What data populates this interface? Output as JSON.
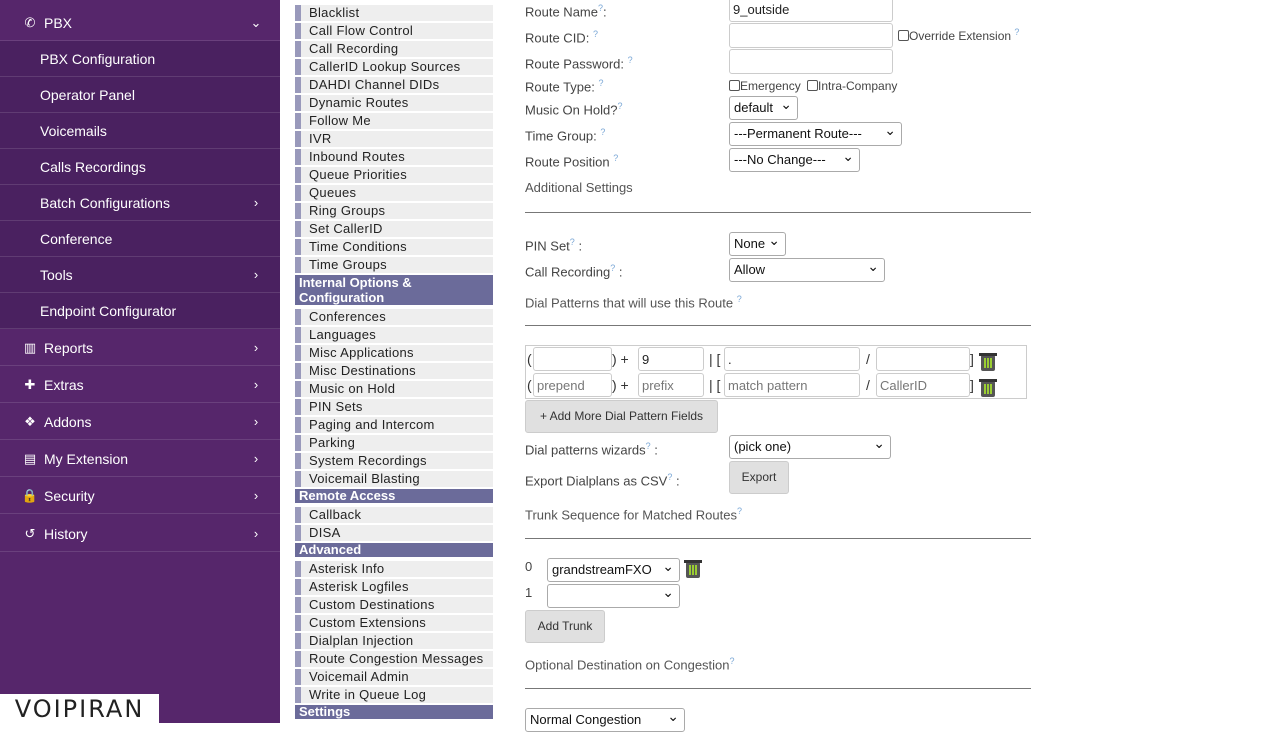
{
  "sidebar": {
    "items": [
      {
        "icon": "phone-icon",
        "glyph": "✆",
        "label": "PBX",
        "chevron": "⌄",
        "sub": false
      },
      {
        "icon": "",
        "glyph": "",
        "label": "PBX Configuration",
        "chevron": "",
        "sub": true
      },
      {
        "icon": "",
        "glyph": "",
        "label": "Operator Panel",
        "chevron": "",
        "sub": true
      },
      {
        "icon": "",
        "glyph": "",
        "label": "Voicemails",
        "chevron": "",
        "sub": true
      },
      {
        "icon": "",
        "glyph": "",
        "label": "Calls Recordings",
        "chevron": "",
        "sub": true
      },
      {
        "icon": "",
        "glyph": "",
        "label": "Batch Configurations",
        "chevron": "›",
        "sub": true
      },
      {
        "icon": "",
        "glyph": "",
        "label": "Conference",
        "chevron": "",
        "sub": true
      },
      {
        "icon": "",
        "glyph": "",
        "label": "Tools",
        "chevron": "›",
        "sub": true
      },
      {
        "icon": "",
        "glyph": "",
        "label": "Endpoint Configurator",
        "chevron": "",
        "sub": true
      },
      {
        "icon": "bar-chart-icon",
        "glyph": "▥",
        "label": "Reports",
        "chevron": "›",
        "sub": false
      },
      {
        "icon": "plus-icon",
        "glyph": "✚",
        "label": "Extras",
        "chevron": "›",
        "sub": false
      },
      {
        "icon": "cubes-icon",
        "glyph": "❖",
        "label": "Addons",
        "chevron": "›",
        "sub": false
      },
      {
        "icon": "id-card-icon",
        "glyph": "▤",
        "label": "My Extension",
        "chevron": "›",
        "sub": false
      },
      {
        "icon": "lock-icon",
        "glyph": "🔒",
        "label": "Security",
        "chevron": "›",
        "sub": false
      },
      {
        "icon": "history-icon",
        "glyph": "↺",
        "label": "History",
        "chevron": "›",
        "sub": false
      }
    ],
    "logo": "VOIPIRAN"
  },
  "modules": [
    {
      "t": "Blacklist",
      "cat": false
    },
    {
      "t": "Call Flow Control",
      "cat": false
    },
    {
      "t": "Call Recording",
      "cat": false
    },
    {
      "t": "CallerID Lookup Sources",
      "cat": false
    },
    {
      "t": "DAHDI Channel DIDs",
      "cat": false
    },
    {
      "t": "Dynamic Routes",
      "cat": false
    },
    {
      "t": "Follow Me",
      "cat": false
    },
    {
      "t": "IVR",
      "cat": false
    },
    {
      "t": "Inbound Routes",
      "cat": false
    },
    {
      "t": "Queue Priorities",
      "cat": false
    },
    {
      "t": "Queues",
      "cat": false
    },
    {
      "t": "Ring Groups",
      "cat": false
    },
    {
      "t": "Set CallerID",
      "cat": false
    },
    {
      "t": "Time Conditions",
      "cat": false
    },
    {
      "t": "Time Groups",
      "cat": false
    },
    {
      "t": "Internal Options & Configuration",
      "cat": true,
      "tall": true
    },
    {
      "t": "Conferences",
      "cat": false
    },
    {
      "t": "Languages",
      "cat": false
    },
    {
      "t": "Misc Applications",
      "cat": false
    },
    {
      "t": "Misc Destinations",
      "cat": false
    },
    {
      "t": "Music on Hold",
      "cat": false
    },
    {
      "t": "PIN Sets",
      "cat": false
    },
    {
      "t": "Paging and Intercom",
      "cat": false
    },
    {
      "t": "Parking",
      "cat": false
    },
    {
      "t": "System Recordings",
      "cat": false
    },
    {
      "t": "Voicemail Blasting",
      "cat": false
    },
    {
      "t": "Remote Access",
      "cat": true
    },
    {
      "t": "Callback",
      "cat": false
    },
    {
      "t": "DISA",
      "cat": false
    },
    {
      "t": "Advanced",
      "cat": true
    },
    {
      "t": "Asterisk Info",
      "cat": false
    },
    {
      "t": "Asterisk Logfiles",
      "cat": false
    },
    {
      "t": "Custom Destinations",
      "cat": false
    },
    {
      "t": "Custom Extensions",
      "cat": false
    },
    {
      "t": "Dialplan Injection",
      "cat": false
    },
    {
      "t": "Route Congestion Messages",
      "cat": false
    },
    {
      "t": "Voicemail Admin",
      "cat": false
    },
    {
      "t": "Write in Queue Log",
      "cat": false
    },
    {
      "t": "Settings",
      "cat": true
    }
  ],
  "form": {
    "route_name_label": "Route Name",
    "route_name_value": "9_outside",
    "route_cid_label": "Route CID:",
    "override_extension_label": "Override Extension",
    "route_password_label": "Route Password:",
    "route_type_label": "Route Type:",
    "emergency_label": "Emergency",
    "intra_company_label": "Intra-Company",
    "music_on_hold_label": "Music On Hold?",
    "music_on_hold_value": "default",
    "time_group_label": "Time Group:",
    "time_group_value": "---Permanent Route---",
    "route_position_label": "Route Position",
    "route_position_value": "---No Change---",
    "additional_settings": "Additional Settings",
    "pin_set_label": "PIN Set",
    "pin_set_value": "None",
    "call_recording_label": "Call Recording",
    "call_recording_value": "Allow",
    "dial_patterns_heading": "Dial Patterns that will use this Route",
    "pattern_row1": {
      "prepend": "",
      "prefix": "9",
      "match": ".",
      "callerid": ""
    },
    "pattern_row2": {
      "prepend": "prepend",
      "prefix": "prefix",
      "match": "match pattern",
      "callerid": "CallerID"
    },
    "add_pattern_button": "+ Add More Dial Pattern Fields",
    "dial_wizards_label": "Dial patterns wizards",
    "dial_wizards_value": "(pick one)",
    "export_label": "Export Dialplans as CSV",
    "export_button": "Export",
    "trunk_sequence_heading": "Trunk Sequence for Matched Routes",
    "trunk0_index": "0",
    "trunk0_value": "grandstreamFXO",
    "trunk1_index": "1",
    "trunk1_value": "",
    "add_trunk_button": "Add Trunk",
    "congestion_heading": "Optional Destination on Congestion",
    "congestion_value": "Normal Congestion",
    "help_glyph": "?",
    "colon": ":",
    "paren_open": "(",
    "paren_plus": ") +",
    "bracket_open": "| [",
    "slash": "/",
    "bracket_close": "]"
  }
}
